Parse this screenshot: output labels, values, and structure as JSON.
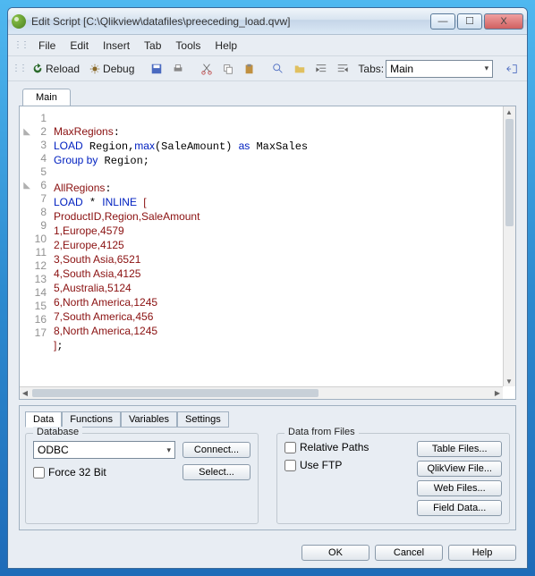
{
  "window": {
    "title": "Edit Script [C:\\Qlikview\\datafiles\\preeceding_load.qvw]"
  },
  "winctl": {
    "min": "—",
    "max": "☐",
    "close": "X"
  },
  "menu": {
    "file": "File",
    "edit": "Edit",
    "insert": "Insert",
    "tab": "Tab",
    "tools": "Tools",
    "help": "Help"
  },
  "toolbar": {
    "reload": "Reload",
    "debug": "Debug",
    "tabs_label": "Tabs:",
    "tabs_value": "Main"
  },
  "filetab": {
    "main": "Main"
  },
  "code": {
    "lines": [
      "",
      "MaxRegions:",
      "LOAD Region,max(SaleAmount) as MaxSales",
      "Group by Region;",
      "",
      "AllRegions:",
      "LOAD * INLINE [",
      "ProductID,Region,SaleAmount",
      "1,Europe,4579",
      "2,Europe,4125",
      "3,South Asia,6521",
      "4,South Asia,4125",
      "5,Australia,5124",
      "6,North America,1245",
      "7,South America,456",
      "8,North America,1245",
      "];"
    ]
  },
  "bottom_tabs": {
    "data": "Data",
    "functions": "Functions",
    "variables": "Variables",
    "settings": "Settings"
  },
  "database": {
    "legend": "Database",
    "driver": "ODBC",
    "connect": "Connect...",
    "force32": "Force 32 Bit",
    "select": "Select..."
  },
  "datafiles": {
    "legend": "Data from Files",
    "relpaths": "Relative Paths",
    "useftp": "Use FTP",
    "tablefiles": "Table Files...",
    "qlikview": "QlikView File...",
    "webfiles": "Web Files...",
    "fielddata": "Field Data..."
  },
  "footer": {
    "ok": "OK",
    "cancel": "Cancel",
    "help": "Help"
  }
}
